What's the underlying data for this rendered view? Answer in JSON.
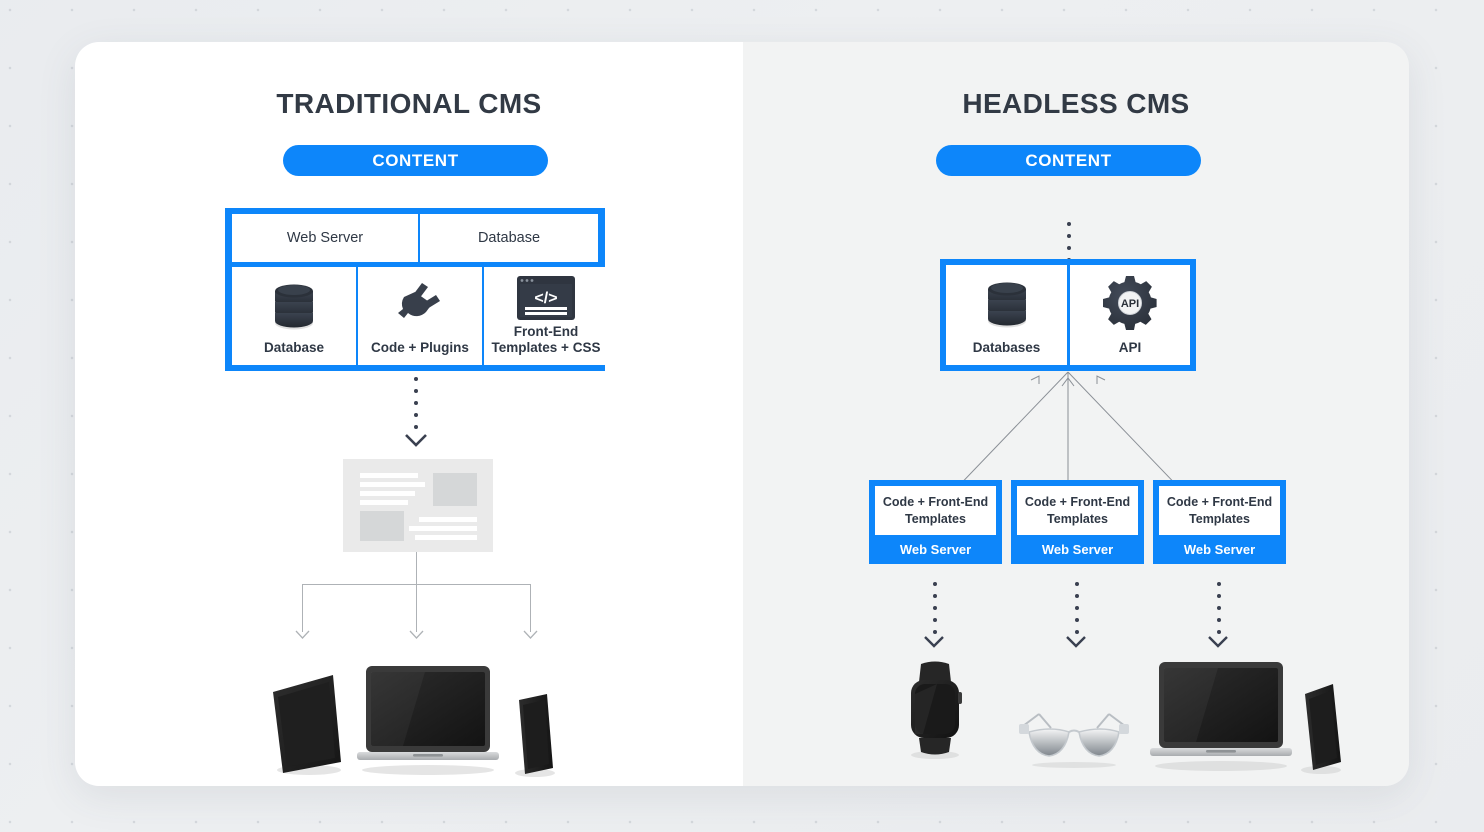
{
  "diagram": {
    "title_left": "TRADITIONAL CMS",
    "title_right": "HEADLESS CMS",
    "accent_color": "#0d86fa",
    "text_color": "#323a45",
    "panel_left_bg": "#ffffff",
    "panel_right_bg": "#f2f3f3"
  },
  "traditional": {
    "heading": "TRADITIONAL CMS",
    "content_pill": "CONTENT",
    "top_row": [
      {
        "label": "Web Server"
      },
      {
        "label": "Database"
      }
    ],
    "tiles": [
      {
        "label": "Database",
        "icon": "database-icon"
      },
      {
        "label": "Code + Plugins",
        "icon": "plug-icon"
      },
      {
        "label": "Front-End\nTemplates + CSS",
        "label_line1": "Front-End",
        "label_line2": "Templates + CSS",
        "icon": "code-window-icon"
      }
    ],
    "output_mock": "website-wireframe",
    "devices": [
      {
        "name": "tablet"
      },
      {
        "name": "laptop"
      },
      {
        "name": "smartphone"
      }
    ]
  },
  "headless": {
    "heading": "HEADLESS CMS",
    "content_pill": "CONTENT",
    "tiles": [
      {
        "label": "Databases",
        "icon": "database-icon"
      },
      {
        "label": "API",
        "icon": "gear-api-icon",
        "glyph_text": "API"
      }
    ],
    "web_servers": [
      {
        "title_line1": "Code + Front-End",
        "title_line2": "Templates",
        "footer": "Web Server"
      },
      {
        "title_line1": "Code + Front-End",
        "title_line2": "Templates",
        "footer": "Web Server"
      },
      {
        "title_line1": "Code + Front-End",
        "title_line2": "Templates",
        "footer": "Web Server"
      }
    ],
    "devices": [
      {
        "name": "smartwatch"
      },
      {
        "name": "smart-glasses"
      },
      {
        "name": "laptop"
      },
      {
        "name": "smartphone"
      }
    ]
  }
}
